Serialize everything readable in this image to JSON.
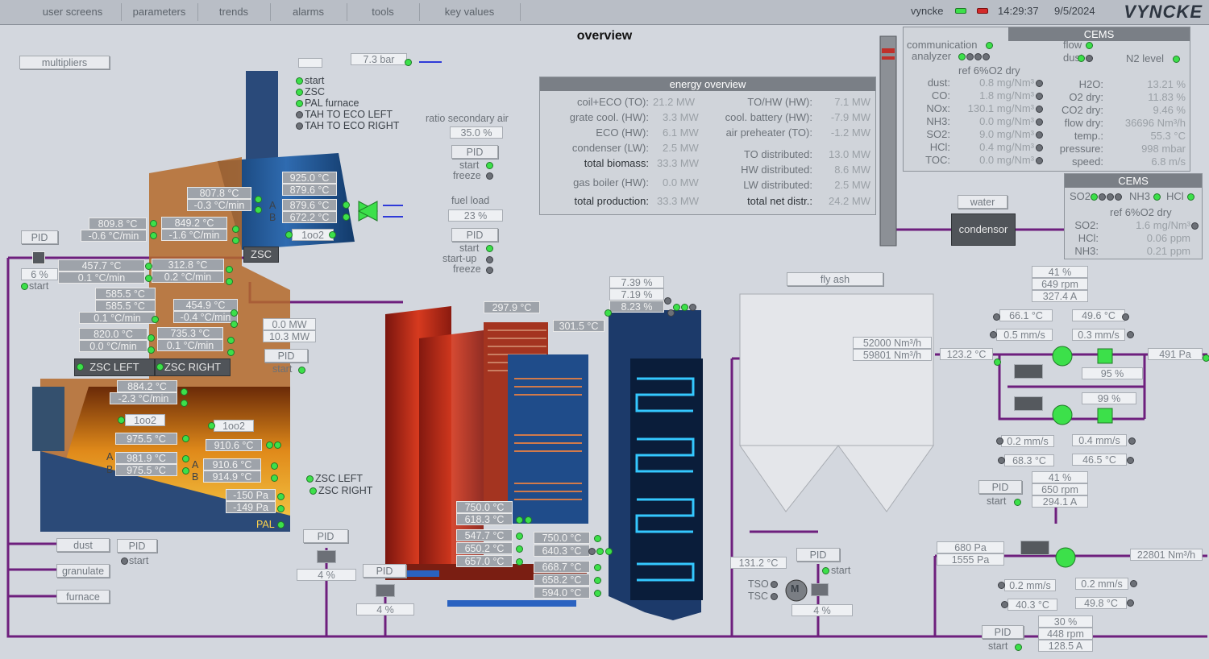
{
  "menu": [
    "user screens",
    "parameters",
    "trends",
    "alarms",
    "tools",
    "key values"
  ],
  "header": {
    "user": "vyncke",
    "time": "14:29:37",
    "date": "9/5/2024",
    "logo": "VYNCKE"
  },
  "title": "overview",
  "left": {
    "multipliers": "multipliers",
    "top_pressure": "7.3 bar",
    "status_list": [
      "start",
      "ZSC",
      "PAL furnace",
      "TAH TO ECO LEFT",
      "TAH TO ECO RIGHT"
    ],
    "t1": "925.0 °C",
    "t2": "879.6 °C",
    "t3": "807.8 °C",
    "r3": "-0.3 °C/min",
    "a_label": "A",
    "a_val": "879.6 °C",
    "b_label": "B",
    "b_val": "672.2 °C",
    "t4": "809.8 °C",
    "r4": "-0.6 °C/min",
    "t5": "849.2 °C",
    "r5": "-1.6 °C/min",
    "oo2_a": "1oo2",
    "pid_left": "PID",
    "zsc": "ZSC",
    "six_pct": "6 %",
    "start_left": "start",
    "t6": "457.7 °C",
    "r6": "0.1 °C/min",
    "t7": "312.8 °C",
    "r7": "0.2 °C/min",
    "t8": "585.5 °C",
    "t9": "585.5 °C",
    "r9": "0.1 °C/min",
    "t10": "454.9 °C",
    "r10": "-0.4 °C/min",
    "t11": "820.0 °C",
    "r11": "0.0 °C/min",
    "t12": "735.3 °C",
    "r12": "0.1 °C/min",
    "zsc_left": "ZSC LEFT",
    "zsc_right": "ZSC RIGHT",
    "t13": "884.2 °C",
    "r13": "-2.3 °C/min",
    "oo2_b": "1oo2",
    "oo2_c": "1oo2",
    "t14": "975.5 °C",
    "t15": "910.6 °C",
    "t16": "981.9 °C",
    "t17": "975.5 °C",
    "t18": "910.6 °C",
    "t19": "914.9 °C",
    "a2": "A",
    "b2": "B",
    "a3": "A",
    "b3": "B",
    "p1": "-150 Pa",
    "p2": "-149 Pa",
    "pal": "PAL",
    "zsc_left2": "ZSC LEFT",
    "zsc_right2": "ZSC RIGHT",
    "dust": "dust",
    "granulate": "granulate",
    "furnace": "furnace",
    "pid_dust": "PID",
    "start_dust": "start"
  },
  "mid": {
    "ratio_label": "ratio secondary air",
    "ratio_val": "35.0 %",
    "pid1": "PID",
    "start1": "start",
    "freeze1": "freeze",
    "fuel_label": "fuel load",
    "fuel_val": "23 %",
    "pid2": "PID",
    "start2": "start",
    "startup2": "start-up",
    "freeze2": "freeze",
    "mw1": "0.0 MW",
    "mw2": "10.3 MW",
    "pid3": "PID",
    "start3": "start",
    "t_boiler1": "297.9 °C",
    "t_boiler2": "301.5 °C",
    "pct1": "7.39 %",
    "pct2": "7.19 %",
    "pct3": "8.23 %",
    "pid4": "PID",
    "pct4": "4 %",
    "pid5": "PID",
    "pct5": "4 %",
    "e1": "750.0 °C",
    "e2": "618.3 °C",
    "e3": "547.7 °C",
    "e4": "650.2 °C",
    "e5": "657.0 °C",
    "e6": "750.0 °C",
    "e7": "640.3 °C",
    "e8": "668.7 °C",
    "e9": "658.2 °C",
    "e10": "594.0 °C"
  },
  "energy": {
    "title": "energy overview",
    "left_rows": [
      {
        "label": "coil+ECO (TO):",
        "value": "21.2 MW"
      },
      {
        "label": "grate cool. (HW):",
        "value": "3.3 MW"
      },
      {
        "label": "ECO (HW):",
        "value": "6.1 MW"
      },
      {
        "label": "condenser (LW):",
        "value": "2.5 MW"
      },
      {
        "label": "total biomass:",
        "value": "33.3 MW"
      },
      {
        "label": "gas boiler (HW):",
        "value": "0.0 MW"
      },
      {
        "label": "total production:",
        "value": "33.3 MW"
      }
    ],
    "right_rows": [
      {
        "label": "TO/HW (HW):",
        "value": "7.1 MW"
      },
      {
        "label": "cool. battery (HW):",
        "value": "-7.9 MW"
      },
      {
        "label": "air preheater (TO):",
        "value": "-1.2 MW"
      },
      {
        "label": "TO distributed:",
        "value": "13.0 MW"
      },
      {
        "label": "HW distributed:",
        "value": "8.6 MW"
      },
      {
        "label": "LW distributed:",
        "value": "2.5 MW"
      },
      {
        "label": "total net distr.:",
        "value": "24.2 MW"
      }
    ]
  },
  "cems1": {
    "title": "CEMS",
    "communication": "communication",
    "analyzer": "analyzer",
    "flow": "flow",
    "dust": "dust",
    "n2": "N2 level",
    "ref": "ref 6%O2 dry",
    "left_rows": [
      {
        "label": "dust:",
        "value": "0.8 mg/Nm³"
      },
      {
        "label": "CO:",
        "value": "1.8 mg/Nm³"
      },
      {
        "label": "NOx:",
        "value": "130.1 mg/Nm³"
      },
      {
        "label": "NH3:",
        "value": "0.0 mg/Nm³"
      },
      {
        "label": "SO2:",
        "value": "9.0 mg/Nm³"
      },
      {
        "label": "HCl:",
        "value": "0.4 mg/Nm³"
      },
      {
        "label": "TOC:",
        "value": "0.0 mg/Nm³"
      }
    ],
    "right_rows": [
      {
        "label": "H2O:",
        "value": "13.21 %"
      },
      {
        "label": "O2 dry:",
        "value": "11.83 %"
      },
      {
        "label": "CO2 dry:",
        "value": "9.46 %"
      },
      {
        "label": "flow dry:",
        "value": "36696 Nm³/h"
      },
      {
        "label": "temp.:",
        "value": "55.3 °C"
      },
      {
        "label": "pressure:",
        "value": "998 mbar"
      },
      {
        "label": "speed:",
        "value": "6.8 m/s"
      }
    ]
  },
  "cems2": {
    "title": "CEMS",
    "so2": "SO2",
    "nh3": "NH3",
    "hcl": "HCl",
    "ref": "ref 6%O2 dry",
    "rows": [
      {
        "label": "SO2:",
        "value": "1.6 mg/Nm³"
      },
      {
        "label": "HCl:",
        "value": "0.06 ppm"
      },
      {
        "label": "NH3:",
        "value": "0.21 ppm"
      }
    ]
  },
  "right": {
    "water": "water",
    "condensor": "condensor",
    "fly_ash": "fly ash",
    "flow1": "52000 Nm³/h",
    "flow2": "59801 Nm³/h",
    "t_in": "123.2 °C",
    "fan1_pct": "41 %",
    "fan1_rpm": "649 rpm",
    "fan1_a": "327.4 A",
    "t_a": "66.1 °C",
    "t_b": "49.6 °C",
    "v_a": "0.5 mm/s",
    "v_b": "0.3 mm/s",
    "p491": "491 Pa",
    "pct95": "95 %",
    "pct99": "99 %",
    "v_c": "0.2 mm/s",
    "v_d": "0.4 mm/s",
    "t_c": "68.3 °C",
    "t_d": "46.5 °C",
    "pid_r1": "PID",
    "start_r1": "start",
    "fan2_pct": "41 %",
    "fan2_rpm": "650 rpm",
    "fan2_a": "294.1 A",
    "t_out": "131.2 °C",
    "pid_r2": "PID",
    "start_r2": "start",
    "tso": "TSO",
    "tsc": "TSC",
    "m": "M",
    "pct_r": "4 %",
    "p680": "680 Pa",
    "p1555": "1555 Pa",
    "flow3": "22801 Nm³/h",
    "v_e": "0.2 mm/s",
    "v_f": "0.2 mm/s",
    "t_e": "40.3 °C",
    "t_f": "49.8 °C",
    "pid_r3": "PID",
    "start_r3": "start",
    "fan3_pct": "30 %",
    "fan3_rpm": "448 rpm",
    "fan3_a": "128.5 A"
  }
}
